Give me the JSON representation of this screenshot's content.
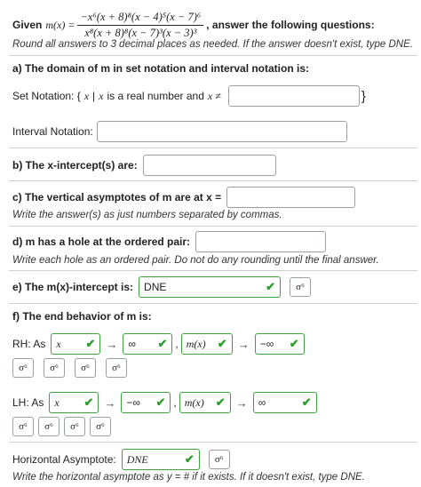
{
  "header": {
    "given_label": "Given",
    "func_name": "m(x) =",
    "numerator": "−x⁶(x + 8)⁸(x − 4)⁵(x − 7)⁶",
    "denominator": "x⁸(x + 8)⁸(x − 7)³(x − 3)³",
    "instruction": ", answer the following questions:",
    "round_note": "Round all answers to 3 decimal places as needed. If the answer doesn't exist, type DNE."
  },
  "part_a": {
    "title": "a) The domain of m in set notation and interval notation is:",
    "set_label_pre": "Set Notation: {",
    "set_label_var": "x",
    "set_label_mid": "|",
    "set_label_var2": "x",
    "set_label_post": "is a real number and",
    "set_label_neq": "x ≠",
    "set_close": "}",
    "set_value": "",
    "interval_label": "Interval Notation:",
    "interval_value": ""
  },
  "part_b": {
    "title": "b) The x-intercept(s) are:",
    "value": ""
  },
  "part_c": {
    "title": "c) The vertical asymptotes of m are at x =",
    "value": "",
    "note": "Write the answer(s) as just numbers separated by commas."
  },
  "part_d": {
    "title": "d) m has a hole at the ordered pair:",
    "value": "",
    "note": "Write each hole as an ordered pair. Do not do any rounding until the final answer."
  },
  "part_e": {
    "title": "e) The m(x)-intercept is:",
    "value": "DNE",
    "key_icon": "σ⁶"
  },
  "part_f": {
    "title": "f) The end behavior of m is:",
    "rh": {
      "label": "RH: As",
      "x_val": "x",
      "arrow1": "→",
      "x_limit": "∞",
      "comma": ",",
      "m_val": "m(x)",
      "arrow2": "→",
      "m_limit": "−∞"
    },
    "lh": {
      "label": "LH: As",
      "x_val": "x",
      "arrow1": "→",
      "x_limit": "−∞",
      "comma": ",",
      "m_val": "m(x)",
      "arrow2": "→",
      "m_limit": "∞"
    },
    "key_icon": "σ⁶"
  },
  "horizontal": {
    "label": "Horizontal Asymptote:",
    "value": "DNE",
    "key_icon": "σ⁶",
    "note": "Write the horizontal asymptote as y = # if it exists. If it doesn't exist, type DNE."
  },
  "colors": {
    "correct": "#3ea33e",
    "border": "#9aa0a6",
    "divider": "#cfcfcf"
  }
}
